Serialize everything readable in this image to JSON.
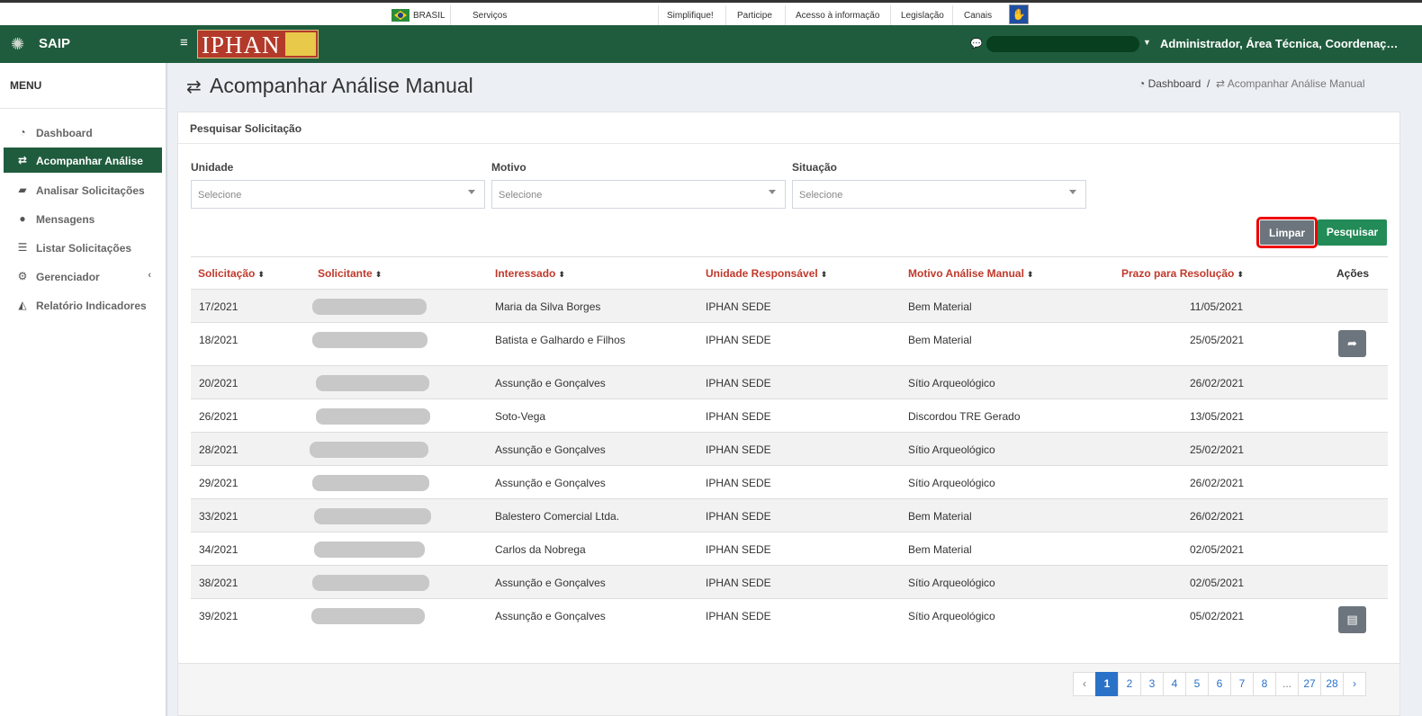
{
  "govbar": {
    "brasil": "BRASIL",
    "servicos": "Serviços",
    "links": [
      "Simplifique!",
      "Participe",
      "Acesso à informação",
      "Legislação",
      "Canais"
    ]
  },
  "header": {
    "app_name": "SAIP",
    "logo_text": "IPHAN",
    "user_label": "Administrador, Área Técnica, Coordenação..."
  },
  "sidebar": {
    "title": "MENU",
    "items": [
      {
        "label": "Dashboard",
        "icon": "dashboard-icon"
      },
      {
        "label": "Acompanhar Análise",
        "icon": "exchange-icon",
        "active": true
      },
      {
        "label": "Analisar Solicitações",
        "icon": "book-icon"
      },
      {
        "label": "Mensagens",
        "icon": "comments-icon"
      },
      {
        "label": "Listar Solicitações",
        "icon": "list-icon"
      },
      {
        "label": "Gerenciador",
        "icon": "cogs-icon"
      },
      {
        "label": "Relatório Indicadores",
        "icon": "area-chart-icon"
      }
    ]
  },
  "page": {
    "title": "Acompanhar Análise Manual",
    "breadcrumb": {
      "home": "Dashboard",
      "current": "Acompanhar Análise Manual"
    }
  },
  "search": {
    "panel_title": "Pesquisar Solicitação",
    "fields": [
      {
        "label": "Unidade",
        "value": "Selecione"
      },
      {
        "label": "Motivo",
        "value": "Selecione"
      },
      {
        "label": "Situação",
        "value": "Selecione"
      }
    ],
    "clear_label": "Limpar",
    "search_label": "Pesquisar"
  },
  "table": {
    "columns": [
      "Solicitação",
      "Solicitante",
      "Interessado",
      "Unidade Responsável",
      "Motivo Análise Manual",
      "Prazo para Resolução",
      "Ações"
    ],
    "rows": [
      {
        "solicitacao": "17/2021",
        "interessado": "Maria da Silva Borges",
        "unidade": "IPHAN SEDE",
        "motivo": "Bem Material",
        "prazo": "11/05/2021",
        "acao": ""
      },
      {
        "solicitacao": "18/2021",
        "interessado": "Batista e Galhardo e Filhos",
        "unidade": "IPHAN SEDE",
        "motivo": "Bem Material",
        "prazo": "25/05/2021",
        "acao": "share-icon"
      },
      {
        "solicitacao": "20/2021",
        "interessado": "Assunção e Gonçalves",
        "unidade": "IPHAN SEDE",
        "motivo": "Sítio Arqueológico",
        "prazo": "26/02/2021",
        "acao": ""
      },
      {
        "solicitacao": "26/2021",
        "interessado": "Soto-Vega",
        "unidade": "IPHAN SEDE",
        "motivo": "Discordou TRE Gerado",
        "prazo": "13/05/2021",
        "acao": ""
      },
      {
        "solicitacao": "28/2021",
        "interessado": "Assunção e Gonçalves",
        "unidade": "IPHAN SEDE",
        "motivo": "Sítio Arqueológico",
        "prazo": "25/02/2021",
        "acao": ""
      },
      {
        "solicitacao": "29/2021",
        "interessado": "Assunção e Gonçalves",
        "unidade": "IPHAN SEDE",
        "motivo": "Sítio Arqueológico",
        "prazo": "26/02/2021",
        "acao": ""
      },
      {
        "solicitacao": "33/2021",
        "interessado": "Balestero Comercial Ltda.",
        "unidade": "IPHAN SEDE",
        "motivo": "Bem Material",
        "prazo": "26/02/2021",
        "acao": ""
      },
      {
        "solicitacao": "34/2021",
        "interessado": "Carlos da Nobrega",
        "unidade": "IPHAN SEDE",
        "motivo": "Bem Material",
        "prazo": "02/05/2021",
        "acao": ""
      },
      {
        "solicitacao": "38/2021",
        "interessado": "Assunção e Gonçalves",
        "unidade": "IPHAN SEDE",
        "motivo": "Sítio Arqueológico",
        "prazo": "02/05/2021",
        "acao": ""
      },
      {
        "solicitacao": "39/2021",
        "interessado": "Assunção e Gonçalves",
        "unidade": "IPHAN SEDE",
        "motivo": "Sítio Arqueológico",
        "prazo": "05/02/2021",
        "acao": "file-icon"
      }
    ]
  },
  "pagination": {
    "prev": "‹",
    "pages": [
      "1",
      "2",
      "3",
      "4",
      "5",
      "6",
      "7",
      "8",
      "...",
      "27",
      "28"
    ],
    "current": "1",
    "next": "›"
  }
}
